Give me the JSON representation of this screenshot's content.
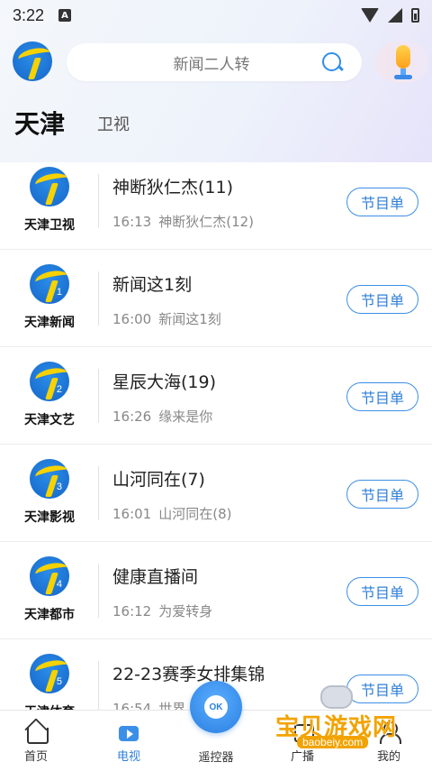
{
  "status_bar": {
    "time": "3:22",
    "notif_badge": "A"
  },
  "search": {
    "placeholder": "新闻二人转"
  },
  "region": {
    "title": "天津",
    "tab": "卫视"
  },
  "channels": [
    {
      "name": "天津卫视",
      "logo_num": "",
      "current": "神断狄仁杰(11)",
      "next_time": "16:13",
      "next_title": "神断狄仁杰(12)",
      "button": "节目单"
    },
    {
      "name": "天津新闻",
      "logo_num": "1",
      "current": "新闻这1刻",
      "next_time": "16:00",
      "next_title": "新闻这1刻",
      "button": "节目单"
    },
    {
      "name": "天津文艺",
      "logo_num": "2",
      "current": "星辰大海(19)",
      "next_time": "16:26",
      "next_title": "缘来是你",
      "button": "节目单"
    },
    {
      "name": "天津影视",
      "logo_num": "3",
      "current": "山河同在(7)",
      "next_time": "16:01",
      "next_title": "山河同在(8)",
      "button": "节目单"
    },
    {
      "name": "天津都市",
      "logo_num": "4",
      "current": "健康直播间",
      "next_time": "16:12",
      "next_title": "为爱转身",
      "button": "节目单"
    },
    {
      "name": "天津体育",
      "logo_num": "5",
      "current": "22-23赛季女排集锦",
      "next_time": "16:54",
      "next_title": "世界…手表演",
      "button": "节目单"
    }
  ],
  "bottom_nav": {
    "home": "首页",
    "tv": "电视",
    "remote": "遥控器",
    "remote_ok": "OK",
    "fourth": "广播",
    "mine": "我的"
  },
  "watermark": {
    "text": "宝贝游戏网",
    "url": "baobeiy.com"
  },
  "colors": {
    "accent": "#2f7fd8",
    "logo_yellow": "#f6d200",
    "logo_blue": "#1565c8"
  }
}
